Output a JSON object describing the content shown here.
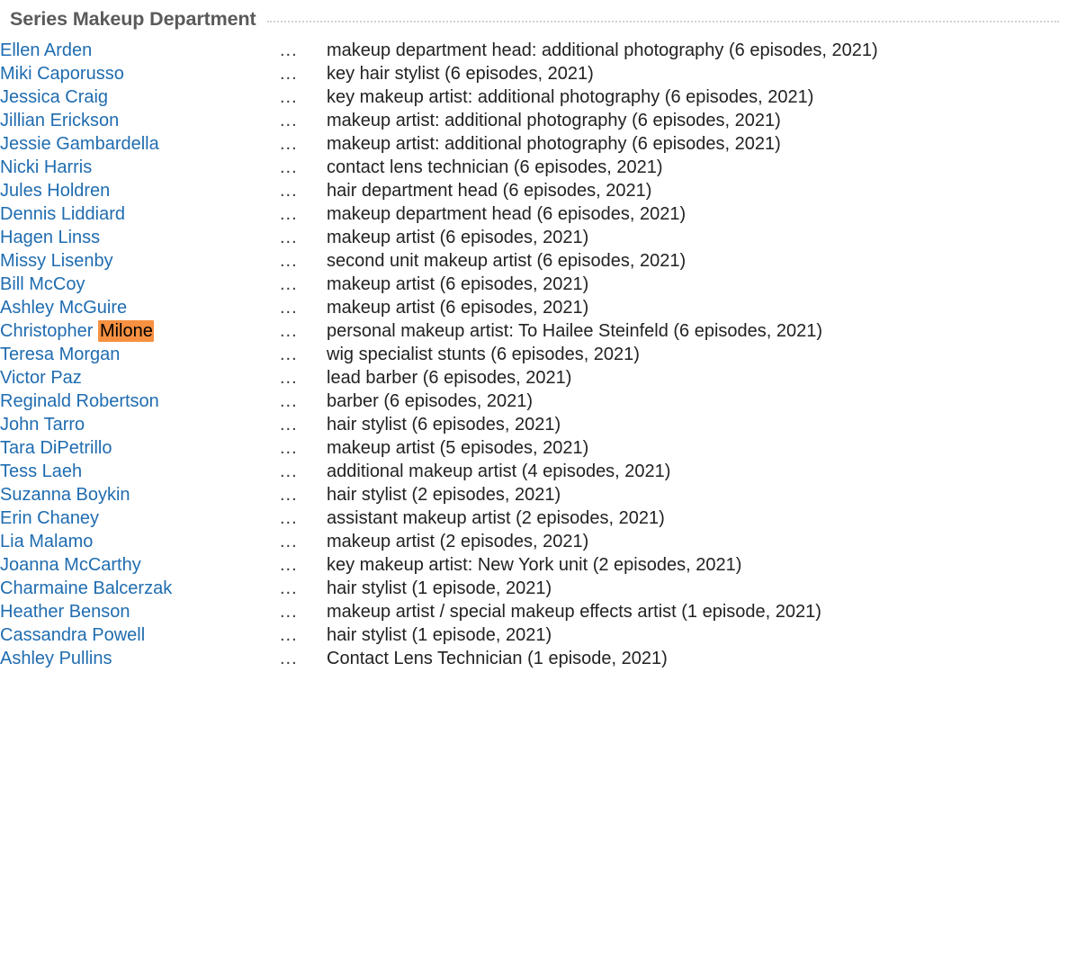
{
  "section": {
    "title": "Series Makeup Department",
    "separator_glyph": "...",
    "highlight_color": "#f79141",
    "link_color": "#1f6cb0",
    "title_color": "#5a5a5a",
    "text_color": "#222222"
  },
  "credits": [
    {
      "name": "Ellen Arden",
      "credit": "makeup department head: additional photography (6 episodes, 2021)"
    },
    {
      "name": "Miki Caporusso",
      "credit": "key hair stylist (6 episodes, 2021)"
    },
    {
      "name": "Jessica Craig",
      "credit": "key makeup artist: additional photography (6 episodes, 2021)"
    },
    {
      "name": "Jillian Erickson",
      "credit": "makeup artist: additional photography (6 episodes, 2021)"
    },
    {
      "name": "Jessie Gambardella",
      "credit": "makeup artist: additional photography (6 episodes, 2021)"
    },
    {
      "name": "Nicki Harris",
      "credit": "contact lens technician (6 episodes, 2021)"
    },
    {
      "name": "Jules Holdren",
      "credit": "hair department head (6 episodes, 2021)"
    },
    {
      "name": "Dennis Liddiard",
      "credit": "makeup department head (6 episodes, 2021)"
    },
    {
      "name": "Hagen Linss",
      "credit": "makeup artist (6 episodes, 2021)"
    },
    {
      "name": "Missy Lisenby",
      "credit": "second unit makeup artist (6 episodes, 2021)"
    },
    {
      "name": "Bill McCoy",
      "credit": "makeup artist (6 episodes, 2021)"
    },
    {
      "name": "Ashley McGuire",
      "credit": "makeup artist (6 episodes, 2021)"
    },
    {
      "name": "Christopher Milone",
      "name_prefix": "Christopher ",
      "name_highlight": "Milone",
      "highlighted": true,
      "credit": "personal makeup artist: To Hailee Steinfeld (6 episodes, 2021)"
    },
    {
      "name": "Teresa Morgan",
      "credit": "wig specialist stunts (6 episodes, 2021)"
    },
    {
      "name": "Victor Paz",
      "credit": "lead barber (6 episodes, 2021)"
    },
    {
      "name": "Reginald Robertson",
      "credit": "barber (6 episodes, 2021)"
    },
    {
      "name": "John Tarro",
      "credit": "hair stylist (6 episodes, 2021)"
    },
    {
      "name": "Tara DiPetrillo",
      "credit": "makeup artist (5 episodes, 2021)"
    },
    {
      "name": "Tess Laeh",
      "credit": "additional makeup artist (4 episodes, 2021)"
    },
    {
      "name": "Suzanna Boykin",
      "credit": "hair stylist (2 episodes, 2021)"
    },
    {
      "name": "Erin Chaney",
      "credit": "assistant makeup artist (2 episodes, 2021)"
    },
    {
      "name": "Lia Malamo",
      "credit": "makeup artist (2 episodes, 2021)"
    },
    {
      "name": "Joanna McCarthy",
      "credit": "key makeup artist: New York unit (2 episodes, 2021)"
    },
    {
      "name": "Charmaine Balcerzak",
      "credit": "hair stylist (1 episode, 2021)"
    },
    {
      "name": "Heather Benson",
      "credit": "makeup artist / special makeup effects artist (1 episode, 2021)"
    },
    {
      "name": "Cassandra Powell",
      "credit": "hair stylist (1 episode, 2021)"
    },
    {
      "name": "Ashley Pullins",
      "credit": "Contact Lens Technician (1 episode, 2021)"
    }
  ]
}
